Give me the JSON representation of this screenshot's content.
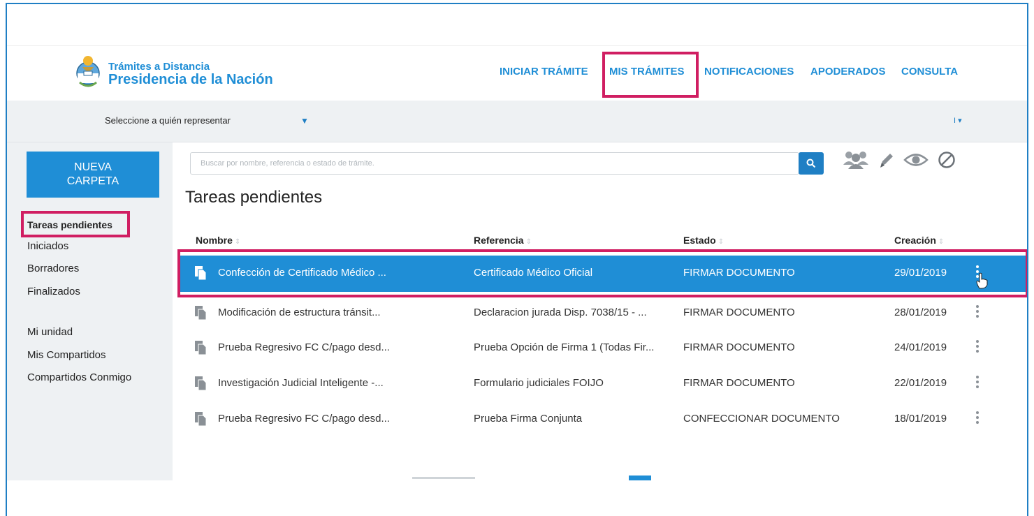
{
  "header": {
    "brand_line1": "Trámites a Distancia",
    "brand_line2": "Presidencia de la Nación",
    "nav": [
      "INICIAR TRÁMITE",
      "MIS TRÁMITES",
      "NOTIFICACIONES",
      "APODERADOS",
      "CONSULTA"
    ],
    "highlighted_nav": "MIS TRÁMITES"
  },
  "represent": {
    "label": "Seleccione a quién representar",
    "caret": "▼",
    "right_caret": "I ▾"
  },
  "sidebar": {
    "new_folder_label": "NUEVA CARPETA",
    "items": [
      "Tareas pendientes",
      "Iniciados",
      "Borradores",
      "Finalizados"
    ],
    "items2": [
      "Mi unidad",
      "Mis Compartidos",
      "Compartidos Conmigo"
    ],
    "active": "Tareas pendientes"
  },
  "search": {
    "placeholder": "Buscar por nombre, referencia o estado de trámite."
  },
  "toolbar_icons": [
    "group-icon",
    "pencil-icon",
    "eye-icon",
    "ban-icon"
  ],
  "main": {
    "title": "Tareas pendientes",
    "columns": [
      "Nombre",
      "Referencia",
      "Estado",
      "Creación"
    ],
    "rows": [
      {
        "nombre": "Confección de Certificado Médico ...",
        "referencia": "Certificado Médico Oficial",
        "estado": "FIRMAR DOCUMENTO",
        "creacion": "29/01/2019",
        "selected": true
      },
      {
        "nombre": "Modificación de estructura tránsit...",
        "referencia": "Declaracion jurada Disp. 7038/15 - ...",
        "estado": "FIRMAR DOCUMENTO",
        "creacion": "28/01/2019",
        "selected": false
      },
      {
        "nombre": "Prueba Regresivo FC C/pago desd...",
        "referencia": "Prueba Opción de Firma 1 (Todas Fir...",
        "estado": "FIRMAR DOCUMENTO",
        "creacion": "24/01/2019",
        "selected": false
      },
      {
        "nombre": "Investigación Judicial Inteligente -...",
        "referencia": "Formulario judiciales FOIJO",
        "estado": "FIRMAR DOCUMENTO",
        "creacion": "22/01/2019",
        "selected": false
      },
      {
        "nombre": "Prueba Regresivo FC C/pago desd...",
        "referencia": "Prueba Firma Conjunta",
        "estado": "CONFECCIONAR DOCUMENTO",
        "creacion": "18/01/2019",
        "selected": false
      }
    ]
  },
  "colors": {
    "accent": "#1f8ed6",
    "highlight": "#d01e62",
    "sidebar_bg": "#eef1f3"
  }
}
